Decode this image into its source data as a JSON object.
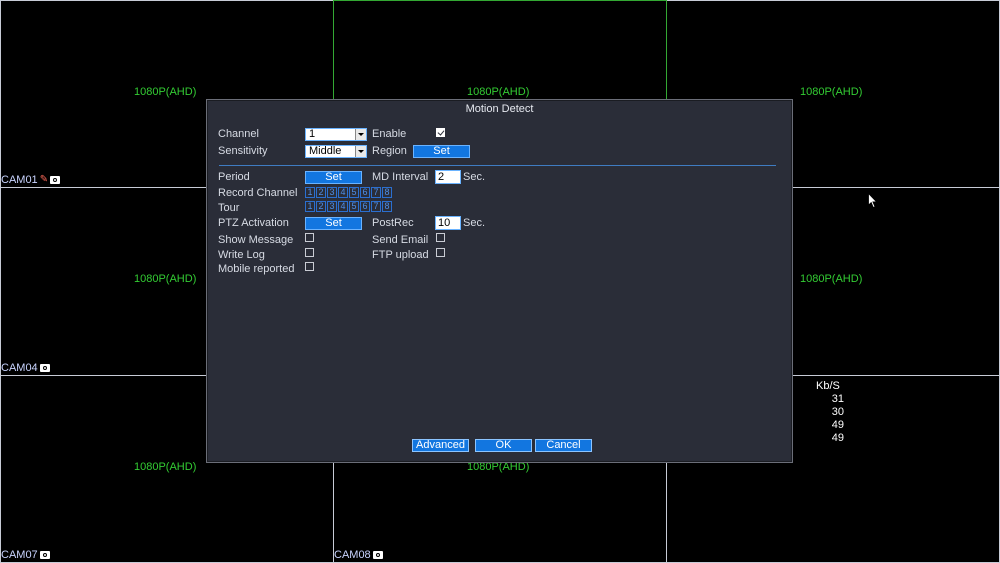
{
  "cameras": [
    {
      "id": "cam01",
      "name": "CAM01",
      "resolution": "1080P(AHD)",
      "motion": true
    },
    {
      "id": "cam02",
      "name": "",
      "resolution": "1080P(AHD)"
    },
    {
      "id": "cam03",
      "name": "",
      "resolution": "1080P(AHD)"
    },
    {
      "id": "cam04",
      "name": "CAM04",
      "resolution": "1080P(AHD)"
    },
    {
      "id": "cam05",
      "name": "",
      "resolution": ""
    },
    {
      "id": "cam06",
      "name": "",
      "resolution": "1080P(AHD)"
    },
    {
      "id": "cam07",
      "name": "CAM07",
      "resolution": "1080P(AHD)"
    },
    {
      "id": "cam08",
      "name": "CAM08",
      "resolution": "1080P(AHD)"
    },
    {
      "id": "cam09",
      "name": "",
      "resolution": ""
    }
  ],
  "bitrate": {
    "header": "Kb/S",
    "values": [
      "31",
      "30",
      "49",
      "49"
    ]
  },
  "dialog": {
    "title": "Motion Detect",
    "channel_label": "Channel",
    "channel_value": "1",
    "enable_label": "Enable",
    "enable_checked": true,
    "sensitivity_label": "Sensitivity",
    "sensitivity_value": "Middle",
    "region_label": "Region",
    "set_label": "Set",
    "period_label": "Period",
    "md_interval_label": "MD Interval",
    "md_interval_value": "2",
    "sec_label": "Sec.",
    "record_channel_label": "Record Channel",
    "tour_label": "Tour",
    "channels": [
      "1",
      "2",
      "3",
      "4",
      "5",
      "6",
      "7",
      "8"
    ],
    "ptz_label": "PTZ Activation",
    "postrec_label": "PostRec",
    "postrec_value": "10",
    "show_message_label": "Show Message",
    "send_email_label": "Send Email",
    "write_log_label": "Write Log",
    "ftp_upload_label": "FTP upload",
    "mobile_reported_label": "Mobile reported",
    "advanced_label": "Advanced",
    "ok_label": "OK",
    "cancel_label": "Cancel"
  },
  "colors": {
    "accent": "#1276e0",
    "resolution_text": "#33cc33",
    "dialog_bg": "#2a2d38"
  }
}
